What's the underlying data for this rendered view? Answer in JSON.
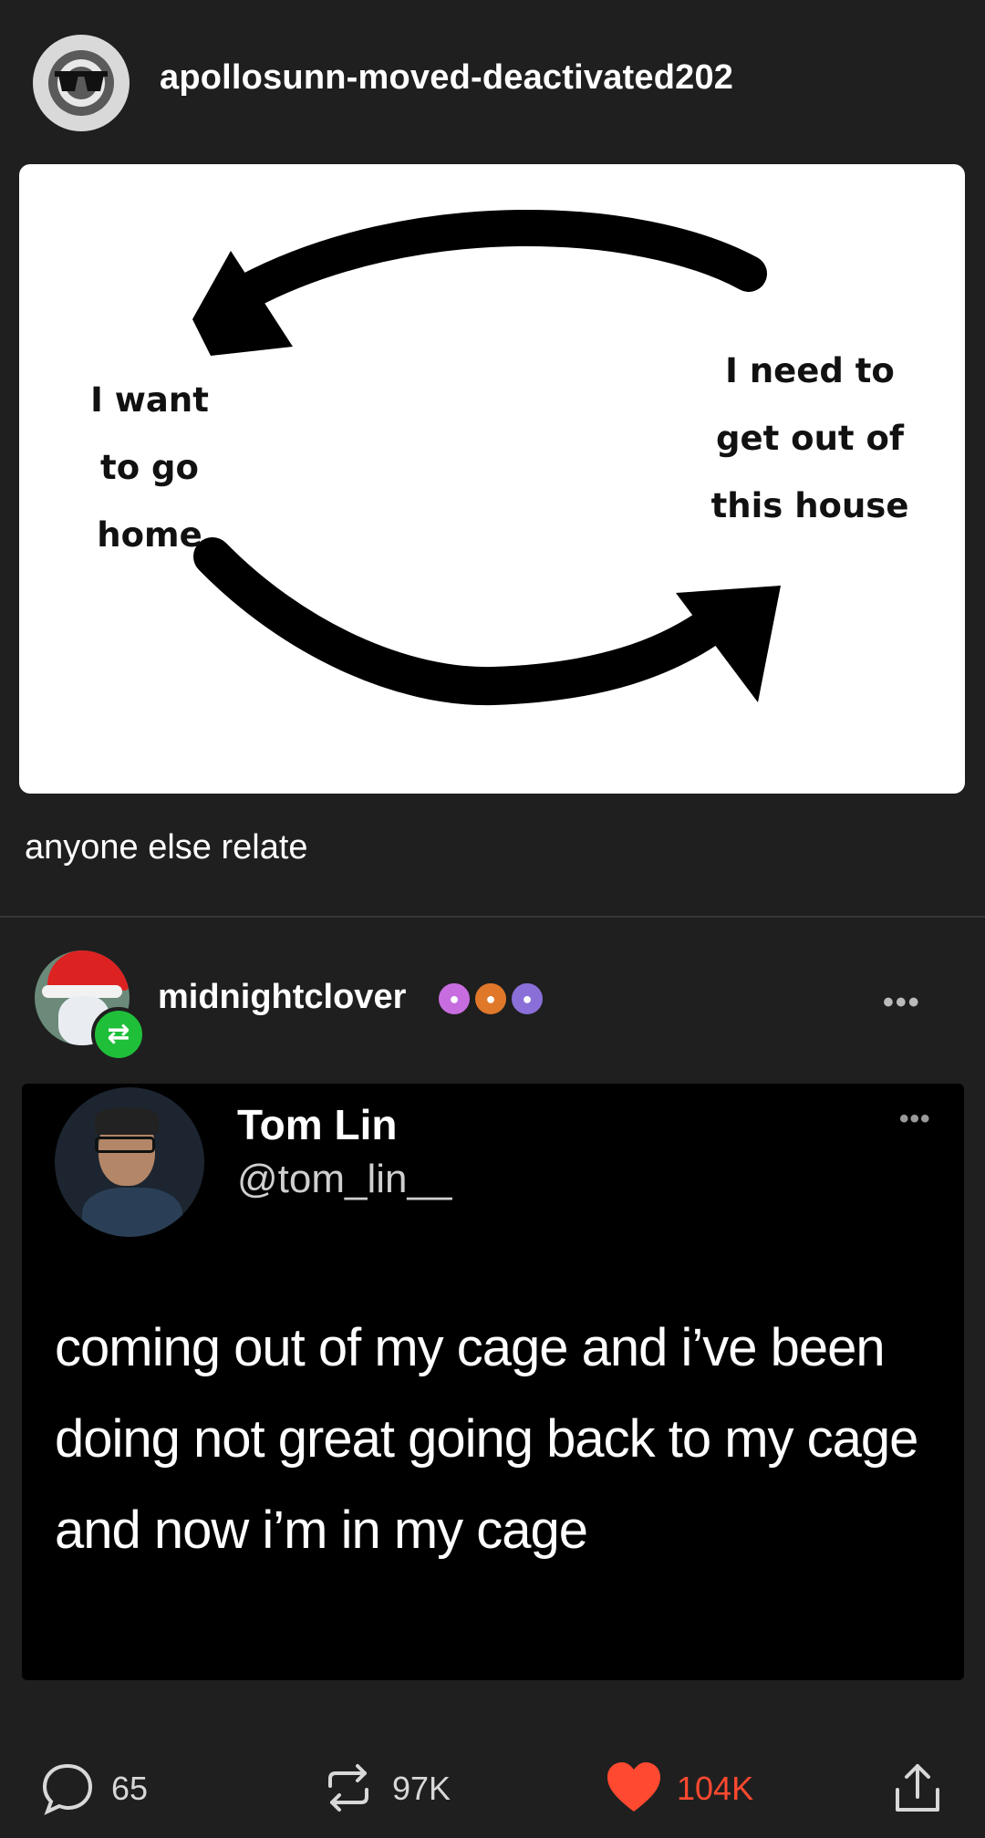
{
  "post": {
    "username": "apollosunn-moved-deactivated202",
    "image_text": {
      "left": [
        "I want",
        "to go home"
      ],
      "right": [
        "I need to",
        "get out of",
        "this house"
      ]
    },
    "caption": "anyone else relate"
  },
  "reblog": {
    "username": "midnightclover",
    "badges": [
      "paw-pink-badge",
      "paw-orange-badge",
      "paw-purple-badge"
    ],
    "more_label": "•••",
    "tweet": {
      "name": "Tom Lin",
      "handle": "@tom_lin__",
      "more_label": "•••",
      "text": "coming out of my cage and i’ve been doing not great going back to my cage and now i’m in my cage"
    }
  },
  "footer": {
    "comments": "65",
    "reblogs": "97K",
    "likes": "104K",
    "liked_color": "#ff4930"
  }
}
